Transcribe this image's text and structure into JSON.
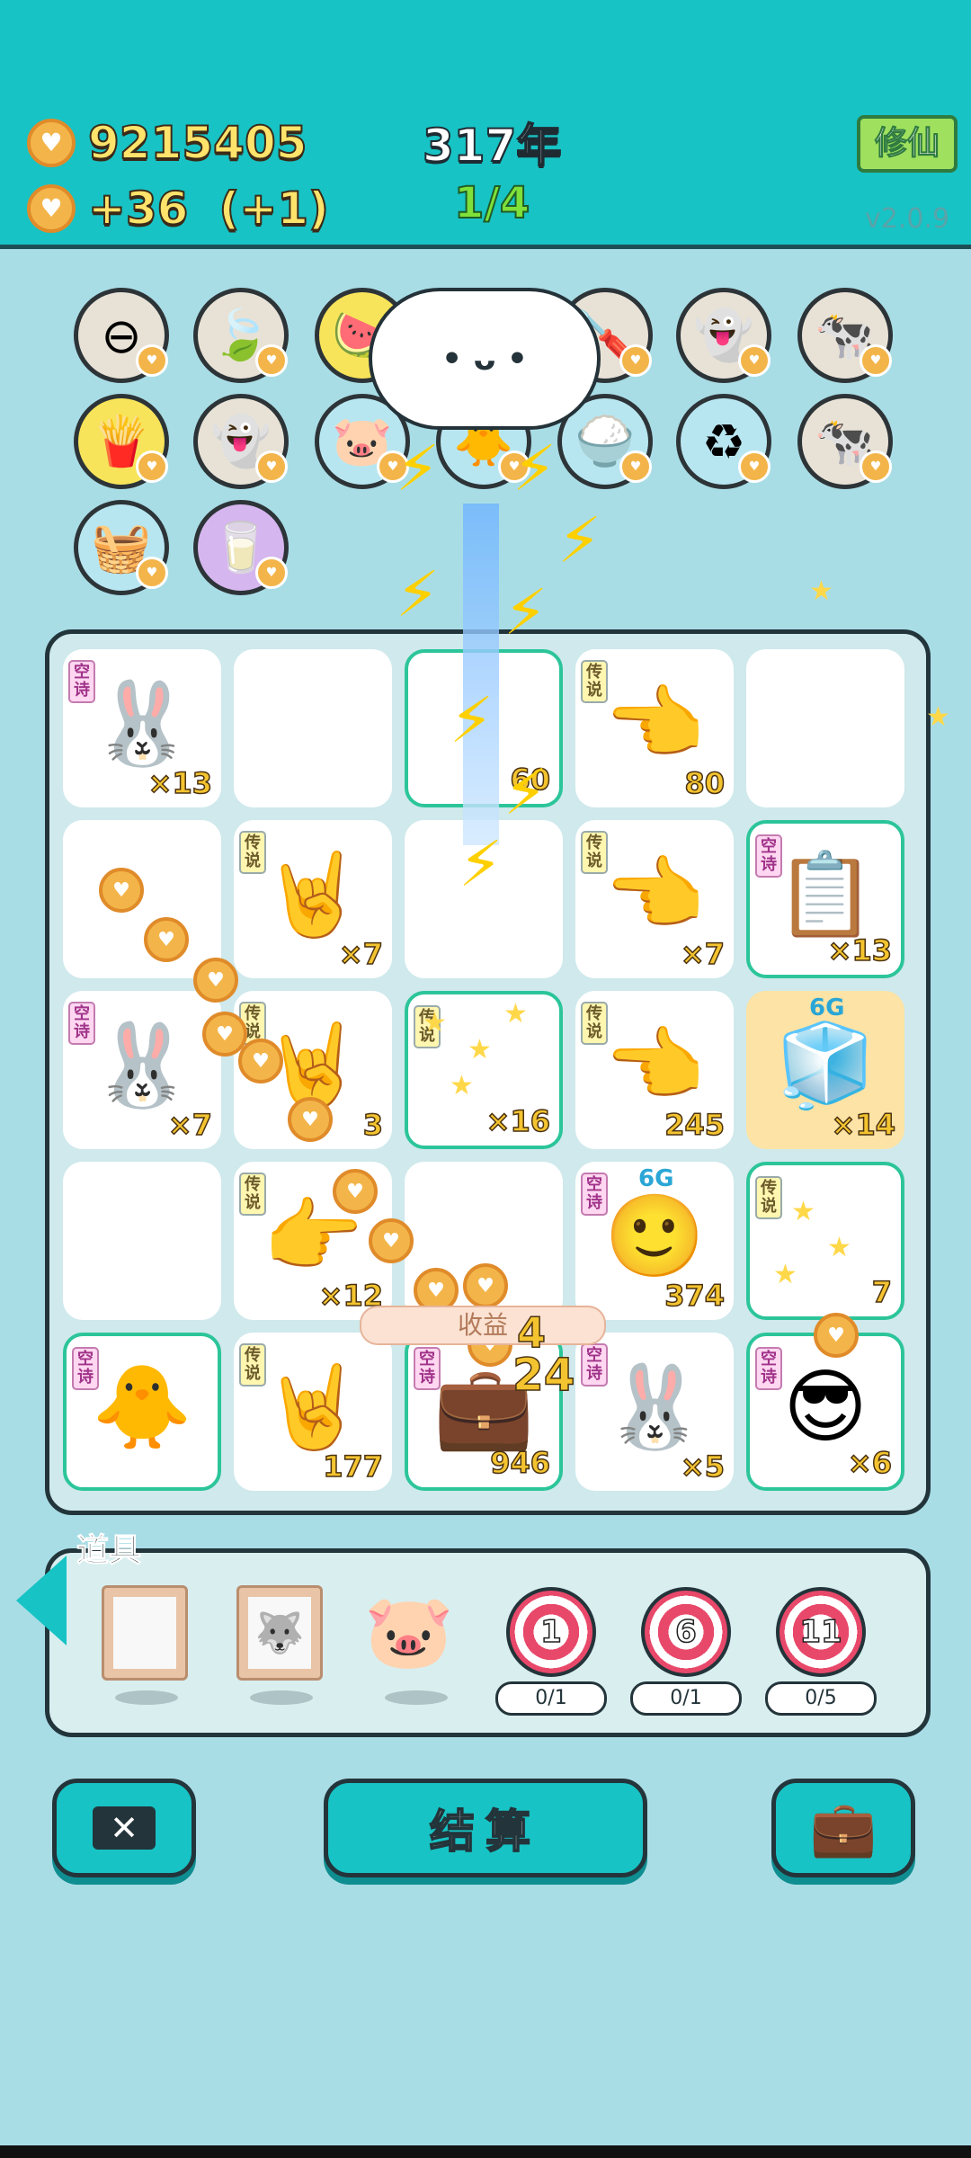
{
  "header": {
    "coins": "9215405",
    "income": "+36",
    "income_bonus": "(+1)",
    "year": "317年",
    "round": "1/4",
    "xiuxian_label": "修仙",
    "version": "v2.0.9"
  },
  "top_items": [
    {
      "name": "minus-item",
      "icon": "⊖"
    },
    {
      "name": "leaf-item",
      "icon": "🍃"
    },
    {
      "name": "fruit-basket-item",
      "icon": "🍉"
    },
    {
      "name": "cloud-item",
      "icon": ""
    },
    {
      "name": "screwdriver-item",
      "icon": "🪛"
    },
    {
      "name": "ghost-item",
      "icon": "👻"
    },
    {
      "name": "cow-pair-item",
      "icon": "🐄"
    },
    {
      "name": "fries-item",
      "icon": "🍟"
    },
    {
      "name": "ghost-tongue-item",
      "icon": "👻"
    },
    {
      "name": "piggy-item",
      "icon": "🐷"
    },
    {
      "name": "chick-egg-item",
      "icon": "🐥"
    },
    {
      "name": "rice-bowl-item",
      "icon": "🍚"
    },
    {
      "name": "trash-bag-item",
      "icon": "♻"
    },
    {
      "name": "cow-pair-item-2",
      "icon": "🐄"
    },
    {
      "name": "strawberry-basket-item",
      "icon": "🧺"
    },
    {
      "name": "milk-jar-item",
      "icon": "🥛"
    }
  ],
  "board": {
    "cells": [
      {
        "tag": "空诗",
        "tagtype": "kong",
        "icon": "🐰",
        "count": "×13"
      },
      {
        "tag": "",
        "icon": "",
        "count": ""
      },
      {
        "tag": "",
        "icon": "",
        "count": "60"
      },
      {
        "tag": "传说",
        "icon": "👈",
        "count": "80"
      },
      {
        "tag": "",
        "icon": "",
        "count": ""
      },
      {
        "tag": "",
        "icon": "",
        "count": ""
      },
      {
        "tag": "传说",
        "icon": "🤘",
        "count": "×7"
      },
      {
        "tag": "",
        "icon": "",
        "count": ""
      },
      {
        "tag": "传说",
        "icon": "👈",
        "count": "×7"
      },
      {
        "tag": "空诗",
        "tagtype": "kong",
        "icon": "📋",
        "count": "×13"
      },
      {
        "tag": "空诗",
        "tagtype": "kong",
        "icon": "🐰",
        "count": "×7"
      },
      {
        "tag": "传说",
        "icon": "🤘",
        "count": "3"
      },
      {
        "tag": "传说",
        "icon": "",
        "count": "×16"
      },
      {
        "tag": "传说",
        "icon": "👈",
        "count": "245"
      },
      {
        "tag": "",
        "icon": "🧊",
        "count": "×14",
        "level": "6G"
      },
      {
        "tag": "",
        "icon": "",
        "count": ""
      },
      {
        "tag": "传说",
        "icon": "👉",
        "count": "×12"
      },
      {
        "tag": "",
        "icon": "",
        "count": ""
      },
      {
        "tag": "空诗",
        "tagtype": "kong",
        "icon": "🙂",
        "count": "374",
        "level": "6G"
      },
      {
        "tag": "传说",
        "icon": "",
        "count": "7"
      },
      {
        "tag": "空诗",
        "tagtype": "kong",
        "icon": "🐥",
        "count": ""
      },
      {
        "tag": "传说",
        "icon": "🤘",
        "count": "177"
      },
      {
        "tag": "空诗",
        "tagtype": "kong",
        "icon": "💼",
        "count": "946"
      },
      {
        "tag": "空诗",
        "tagtype": "kong",
        "icon": "🐰",
        "count": "×5"
      },
      {
        "tag": "空诗",
        "tagtype": "kong",
        "icon": "😎",
        "count": "×6"
      }
    ],
    "gain_label": "收益",
    "float_4": "4",
    "float_24": "24"
  },
  "tools": {
    "title": "道具",
    "targets": [
      {
        "value": "1",
        "progress": "0/1"
      },
      {
        "value": "6",
        "progress": "0/1"
      },
      {
        "value": "11",
        "progress": "0/5"
      }
    ]
  },
  "buttons": {
    "settle_label": "结算"
  },
  "colors": {
    "header": "#17c3c5",
    "background": "#a9dde6",
    "accent_gold": "#f4c430"
  }
}
